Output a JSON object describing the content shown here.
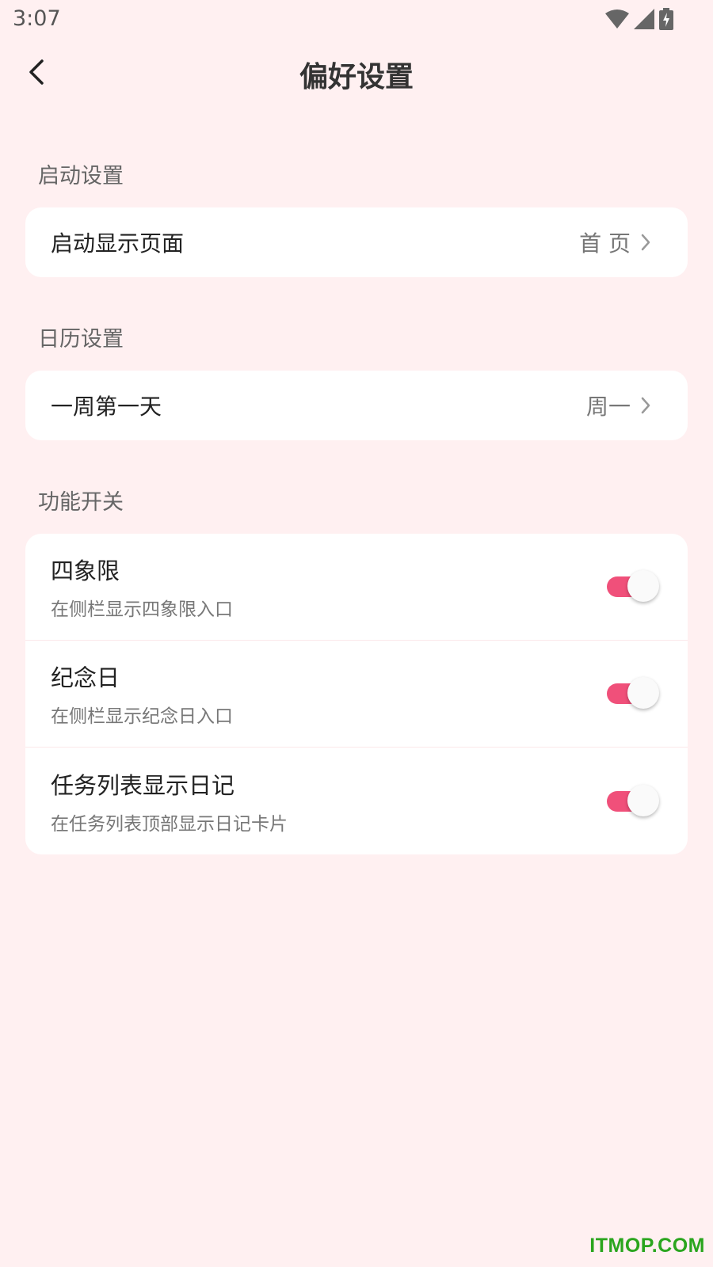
{
  "status_bar": {
    "time": "3:07"
  },
  "header": {
    "title": "偏好设置",
    "back_icon": "chevron-left-icon"
  },
  "sections": {
    "startup": {
      "title": "启动设置",
      "row_label": "启动显示页面",
      "row_value": "首 页"
    },
    "calendar": {
      "title": "日历设置",
      "row_label": "一周第一天",
      "row_value": "周一"
    },
    "features": {
      "title": "功能开关",
      "items": [
        {
          "title": "四象限",
          "desc": "在侧栏显示四象限入口",
          "enabled": true
        },
        {
          "title": "纪念日",
          "desc": "在侧栏显示纪念日入口",
          "enabled": true
        },
        {
          "title": "任务列表显示日记",
          "desc": "在任务列表顶部显示日记卡片",
          "enabled": true
        }
      ]
    }
  },
  "watermark": "ITMOP.COM",
  "colors": {
    "background": "#fff0f1",
    "accent": "#f0507a",
    "watermark": "#2aa51e"
  }
}
